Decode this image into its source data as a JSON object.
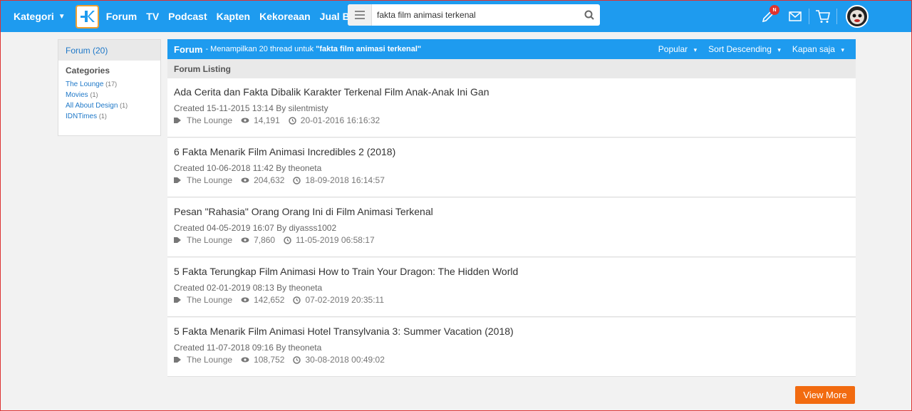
{
  "topbar": {
    "kategori": "Kategori",
    "nav": [
      "Forum",
      "TV",
      "Podcast",
      "Kapten",
      "Kekoreaan",
      "Jual Beli"
    ],
    "search_value": "fakta film animasi terkenal",
    "notif_badge": "N",
    "accent": "#1e9bef"
  },
  "sidebar": {
    "head": "Forum (20)",
    "categories_title": "Categories",
    "categories": [
      {
        "name": "The Lounge",
        "count": "(17)"
      },
      {
        "name": "Movies",
        "count": "(1)"
      },
      {
        "name": "All About Design",
        "count": "(1)"
      },
      {
        "name": "IDNTimes",
        "count": "(1)"
      }
    ]
  },
  "main": {
    "head_title": "Forum",
    "head_desc": "- Menampilkan 20 thread untuk",
    "head_query": "\"fakta film animasi terkenal\"",
    "sorts": [
      "Popular",
      "Sort Descending",
      "Kapan saja"
    ],
    "listing_label": "Forum Listing",
    "threads": [
      {
        "title": "Ada Cerita dan Fakta Dibalik Karakter Terkenal Film Anak-Anak Ini Gan",
        "created": "Created 15-11-2015 13:14 By silentmisty",
        "category": "The Lounge",
        "views": "14,191",
        "updated": "20-01-2016 16:16:32"
      },
      {
        "title": "6 Fakta Menarik Film Animasi Incredibles 2 (2018)",
        "created": "Created 10-06-2018 11:42 By theoneta",
        "category": "The Lounge",
        "views": "204,632",
        "updated": "18-09-2018 16:14:57"
      },
      {
        "title": "Pesan \"Rahasia\" Orang Orang Ini di Film Animasi Terkenal",
        "created": "Created 04-05-2019 16:07 By diyasss1002",
        "category": "The Lounge",
        "views": "7,860",
        "updated": "11-05-2019 06:58:17"
      },
      {
        "title": "5 Fakta Terungkap Film Animasi How to Train Your Dragon: The Hidden World",
        "created": "Created 02-01-2019 08:13 By theoneta",
        "category": "The Lounge",
        "views": "142,652",
        "updated": "07-02-2019 20:35:11"
      },
      {
        "title": "5 Fakta Menarik Film Animasi Hotel Transylvania 3: Summer Vacation (2018)",
        "created": "Created 11-07-2018 09:16 By theoneta",
        "category": "The Lounge",
        "views": "108,752",
        "updated": "30-08-2018 00:49:02"
      }
    ],
    "view_more": "View More"
  }
}
